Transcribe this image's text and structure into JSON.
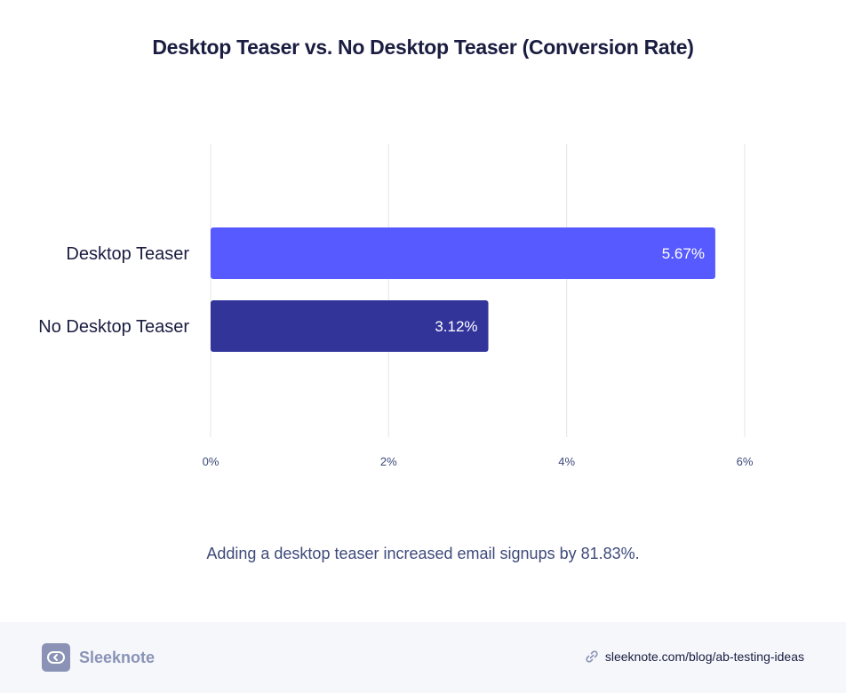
{
  "title": "Desktop Teaser vs. No Desktop Teaser (Conversion Rate)",
  "caption": "Adding a desktop teaser increased email signups by 81.83%.",
  "footer": {
    "brand": "Sleeknote",
    "source_url": "sleeknote.com/blog/ab-testing-ideas"
  },
  "colors": {
    "desktop_teaser": "#575bff",
    "no_desktop_teaser": "#32349a",
    "grid": "#e3e5ee",
    "tick_label": "#3e4a7a",
    "category_label": "#1a1d40"
  },
  "chart_data": {
    "type": "bar",
    "orientation": "horizontal",
    "title": "Desktop Teaser vs. No Desktop Teaser (Conversion Rate)",
    "categories": [
      "Desktop Teaser",
      "No Desktop Teaser"
    ],
    "values": [
      5.67,
      3.12
    ],
    "value_labels": [
      "5.67%",
      "3.12%"
    ],
    "xlim": [
      0,
      6
    ],
    "xticks": [
      0,
      2,
      4,
      6
    ],
    "xtick_labels": [
      "0%",
      "2%",
      "4%",
      "6%"
    ],
    "grid": true,
    "legend": "none"
  }
}
